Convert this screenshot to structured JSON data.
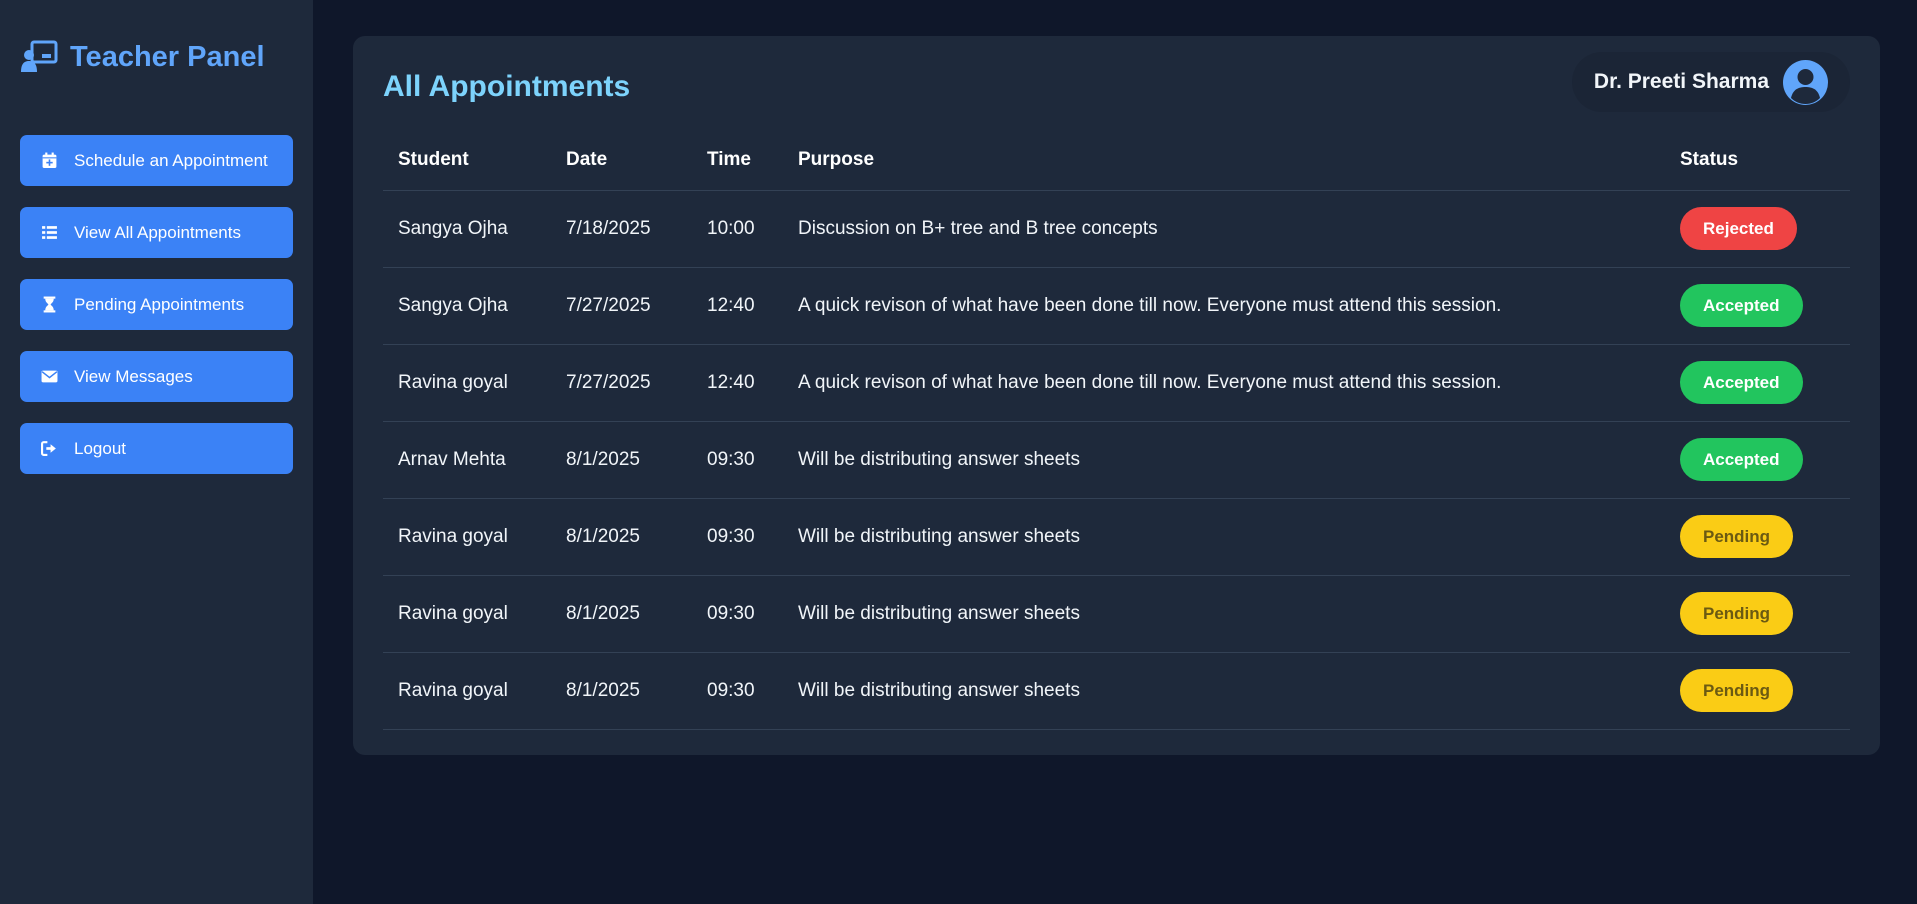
{
  "sidebar": {
    "brand_title": "Teacher Panel",
    "brand_icon": "chalkboard-teacher-icon",
    "items": [
      {
        "label": "Schedule an Appointment",
        "icon": "calendar-plus-icon"
      },
      {
        "label": "View All Appointments",
        "icon": "list-icon"
      },
      {
        "label": "Pending Appointments",
        "icon": "hourglass-icon"
      },
      {
        "label": "View Messages",
        "icon": "envelope-icon"
      },
      {
        "label": "Logout",
        "icon": "sign-out-icon"
      }
    ]
  },
  "main": {
    "title": "All Appointments",
    "user_name": "Dr. Preeti Sharma",
    "table": {
      "headers": [
        "Student",
        "Date",
        "Time",
        "Purpose",
        "Status"
      ],
      "rows": [
        {
          "student": "Sangya Ojha",
          "date": "7/18/2025",
          "time": "10:00",
          "purpose": "Discussion on B+ tree and B tree concepts",
          "status": "Rejected"
        },
        {
          "student": "Sangya Ojha",
          "date": "7/27/2025",
          "time": "12:40",
          "purpose": "A quick revison of what have been done till now. Everyone must attend this session.",
          "status": "Accepted"
        },
        {
          "student": "Ravina goyal",
          "date": "7/27/2025",
          "time": "12:40",
          "purpose": "A quick revison of what have been done till now. Everyone must attend this session.",
          "status": "Accepted"
        },
        {
          "student": "Arnav Mehta",
          "date": "8/1/2025",
          "time": "09:30",
          "purpose": "Will be distributing answer sheets",
          "status": "Accepted"
        },
        {
          "student": "Ravina goyal",
          "date": "8/1/2025",
          "time": "09:30",
          "purpose": "Will be distributing answer sheets",
          "status": "Pending"
        },
        {
          "student": "Ravina goyal",
          "date": "8/1/2025",
          "time": "09:30",
          "purpose": "Will be distributing answer sheets",
          "status": "Pending"
        },
        {
          "student": "Ravina goyal",
          "date": "8/1/2025",
          "time": "09:30",
          "purpose": "Will be distributing answer sheets",
          "status": "Pending"
        }
      ]
    }
  },
  "colors": {
    "page_bg": "#0f172a",
    "panel_bg": "#1e293b",
    "accent": "#3b82f6",
    "title": "#7dd3fc",
    "rejected": "#ef4444",
    "accepted": "#22c55e",
    "pending": "#facc15"
  }
}
